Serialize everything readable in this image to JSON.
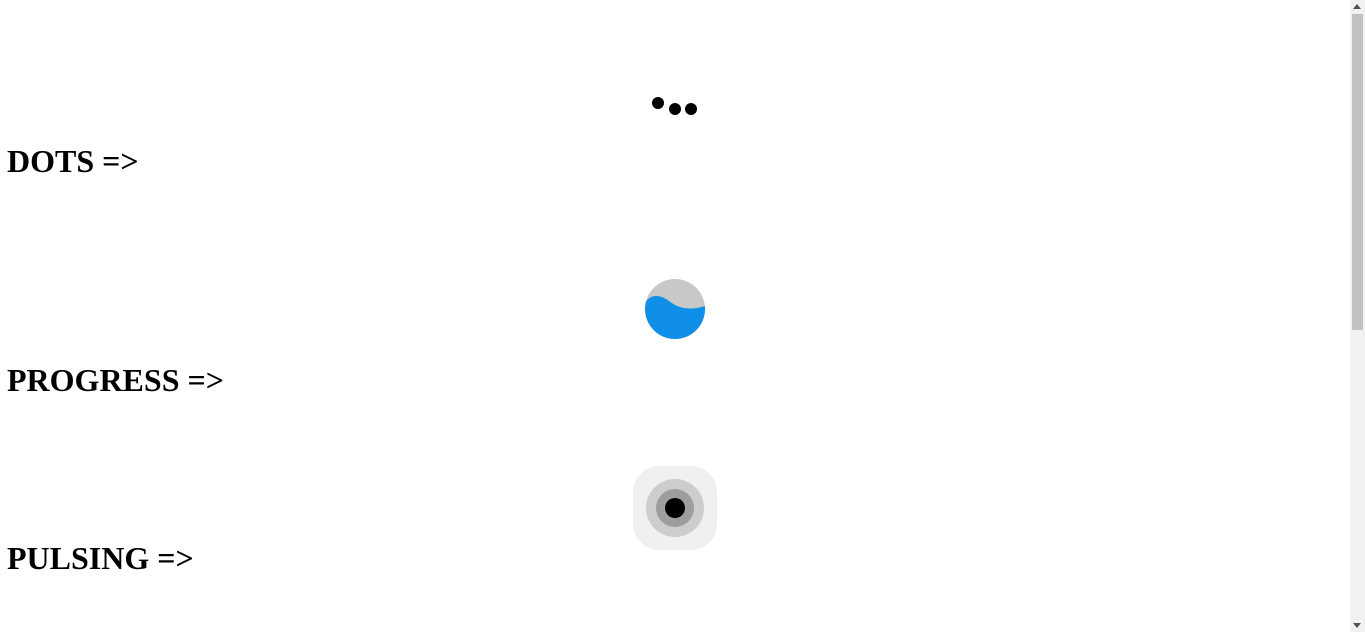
{
  "sections": {
    "dots": {
      "label": "DOTS =>",
      "loader_color": "#000000"
    },
    "progress": {
      "label": "PROGRESS =>",
      "fill_fraction": 0.65,
      "fill_color": "#0f8fe8",
      "track_color": "#c8c8c8"
    },
    "pulsing": {
      "label": "PULSING =>",
      "core_color": "#000000"
    }
  }
}
